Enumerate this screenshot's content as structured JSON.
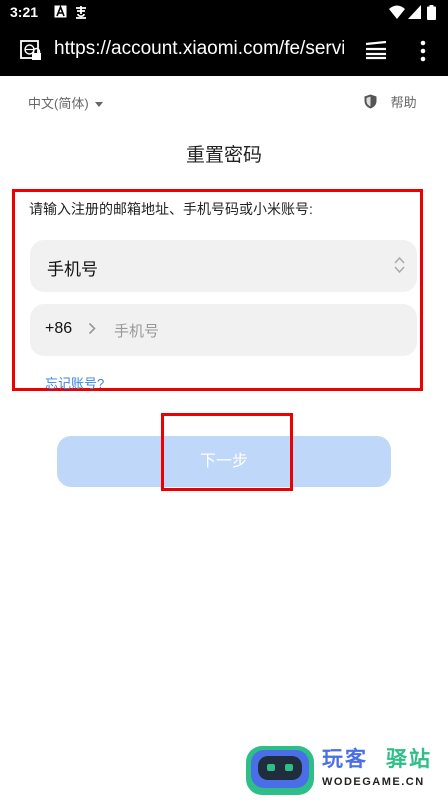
{
  "status_bar": {
    "time": "3:21"
  },
  "browser": {
    "url": "https://account.xiaomi.com/fe/servi"
  },
  "header": {
    "language": "中文(简体)",
    "help": "帮助"
  },
  "page": {
    "title": "重置密码",
    "instruction": "请输入注册的邮箱地址、手机号码或小米账号:",
    "account_type_value": "手机号",
    "country_code": "+86",
    "phone_placeholder": "手机号",
    "forgot_account_link": "忘记账号?",
    "next_button": "下一步"
  },
  "watermark": {
    "brand_1": "玩客",
    "brand_2": "驿站",
    "domain": "WODEGAME.CN"
  },
  "colors": {
    "accent": "#3a83e0",
    "button_disabled": "#bfd7f9",
    "highlight": "#ee0000"
  }
}
